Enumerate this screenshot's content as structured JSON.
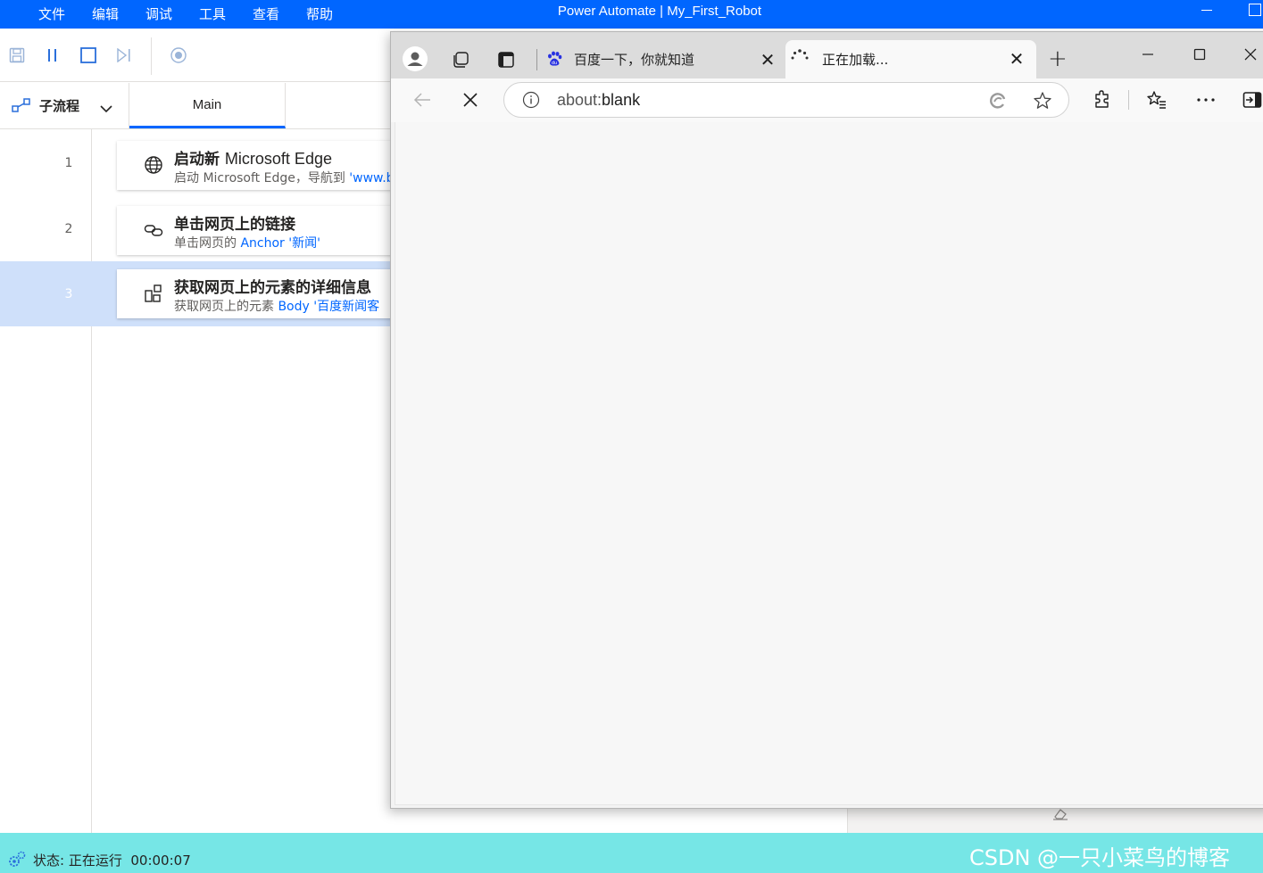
{
  "app": {
    "title": "Power Automate | My_First_Robot",
    "menu": [
      "文件",
      "编辑",
      "调试",
      "工具",
      "查看",
      "帮助"
    ]
  },
  "toolbar": {
    "buttons": [
      "save-icon",
      "pause-icon",
      "stop-icon",
      "step-icon",
      "record-icon"
    ]
  },
  "subflow": {
    "label": "子流程",
    "tab": "Main"
  },
  "actions": [
    {
      "line": "1",
      "icon": "globe-icon",
      "title_cn": "启动新 ",
      "title_en": "Microsoft Edge",
      "desc": "启动 Microsoft Edge，导航到 ",
      "desc_link": "'www.b"
    },
    {
      "line": "2",
      "icon": "link-icon",
      "title_cn": "单击网页上的链接",
      "title_en": "",
      "desc": "单击网页的 ",
      "desc_link": "Anchor '新闻'"
    },
    {
      "line": "3",
      "icon": "element-details-icon",
      "title_cn": "获取网页上的元素的详细信息",
      "title_en": "",
      "desc": "获取网页上的元素 ",
      "desc_link": "Body '百度新闻客"
    }
  ],
  "status": {
    "text": "状态: 正在运行",
    "time": "00:00:07",
    "watermark": "CSDN @一只小菜鸟的博客"
  },
  "browser": {
    "tabs": [
      {
        "title": "百度一下，你就知道",
        "active": false,
        "favicon": "baidu-paw-icon"
      },
      {
        "title": "正在加载...",
        "active": true,
        "favicon": "loading-spinner-icon"
      }
    ],
    "address": {
      "prefix": "about:",
      "value": "blank"
    }
  },
  "colors": {
    "accent": "#0066ff",
    "status_bar": "#76e6e6",
    "selected_row": "#cfe0fa"
  }
}
